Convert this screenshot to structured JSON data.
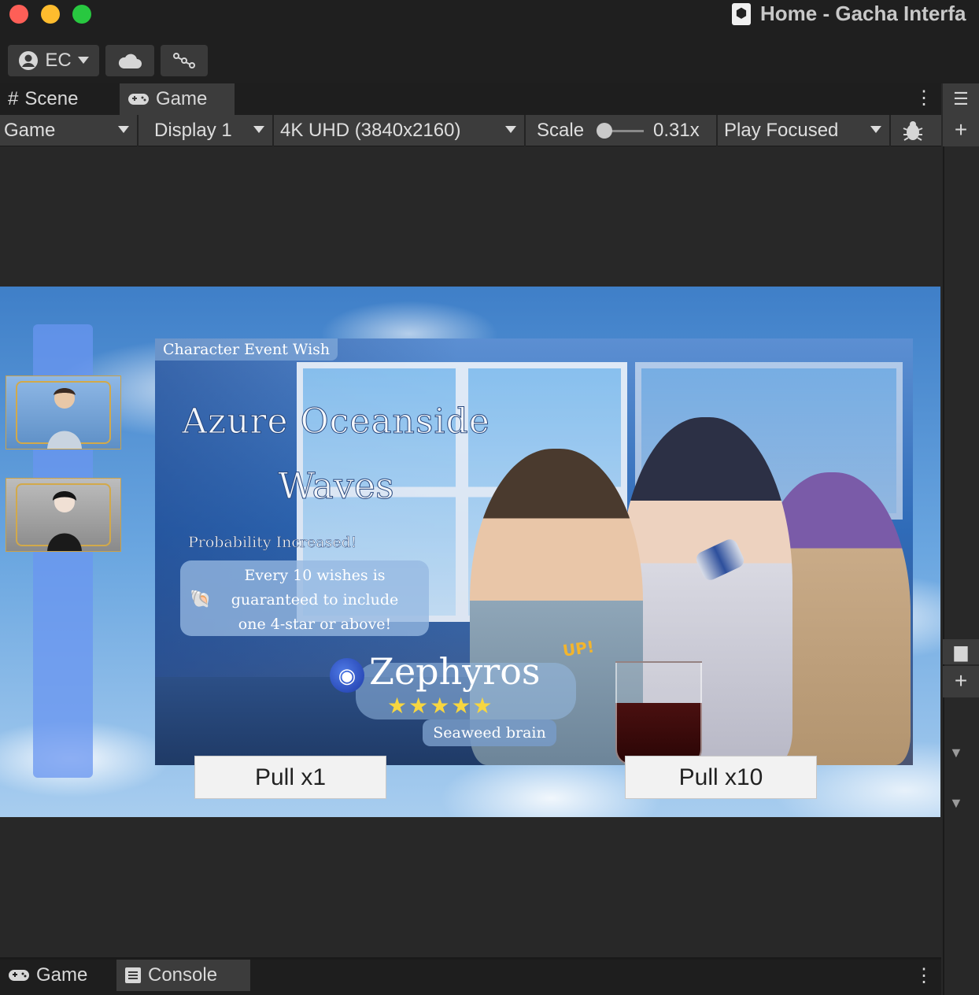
{
  "window": {
    "title": "Home - Gacha Interfa"
  },
  "toolbar": {
    "account_label": "EC"
  },
  "tabs": [
    {
      "label": "Scene",
      "icon": "grid-icon"
    },
    {
      "label": "Game",
      "icon": "gamepad-icon"
    }
  ],
  "game_controls": {
    "target": "Game",
    "display": "Display 1",
    "resolution": "4K UHD (3840x2160)",
    "scale_label": "Scale",
    "scale_value": "0.31x",
    "play_mode": "Play Focused"
  },
  "banner": {
    "event_type": "Character Event Wish",
    "title_line1": "Azure Oceanside",
    "title_line2": "Waves",
    "probability_label": "Probability Increased!",
    "info_lines": [
      "Every 10 wishes is",
      "guaranteed to  include",
      "one 4-star or above!"
    ],
    "character_name": "Zephyros",
    "up_badge": "UP!",
    "stars": "★★★★★",
    "character_subtitle": "Seaweed brain"
  },
  "buttons": {
    "pull_one": "Pull x1",
    "pull_ten": "Pull x10"
  },
  "bottom_tabs": [
    {
      "label": "Game",
      "icon": "gamepad-icon"
    },
    {
      "label": "Console",
      "icon": "console-icon"
    }
  ],
  "colors": {
    "accent_blue": "#6996f0",
    "star_gold": "#f7d640",
    "up_orange": "#f3b52d"
  }
}
